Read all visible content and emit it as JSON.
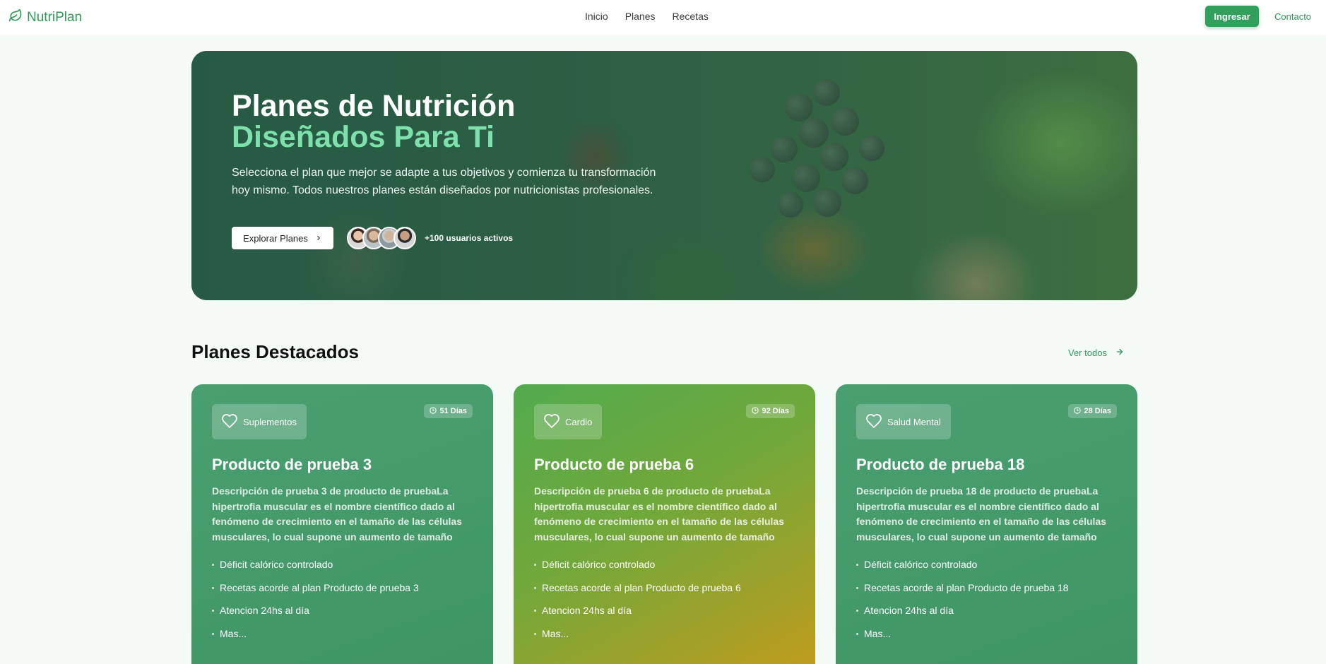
{
  "header": {
    "brand": "NutriPlan",
    "nav": [
      "Inicio",
      "Planes",
      "Recetas"
    ],
    "login_label": "Ingresar",
    "contact_label": "Contacto"
  },
  "hero": {
    "title_line1": "Planes de Nutrición",
    "title_line2": "Diseñados Para Ti",
    "description": "Selecciona el plan que mejor se adapte a tus objetivos y comienza tu transformación hoy mismo. Todos nuestros planes están diseñados por nutricionistas profesionales.",
    "explore_label": "Explorar Planes",
    "users_text": "+100 usuarios activos"
  },
  "section": {
    "title": "Planes Destacados",
    "see_all": "Ver todos"
  },
  "cards": [
    {
      "category": "Suplementos",
      "days": "51 Días",
      "title": "Producto de prueba 3",
      "description": "Descripción de prueba 3 de producto de pruebaLa hipertrofia muscular es el nombre científico dado al fenómeno de crecimiento en el tamaño de las células musculares, lo cual supone un aumento de tamaño de...",
      "features": [
        "Déficit calórico controlado",
        "Recetas acorde al plan Producto de prueba 3",
        "Atencion 24hs al día",
        "Mas..."
      ]
    },
    {
      "category": "Cardio",
      "days": "92 Días",
      "title": "Producto de prueba 6",
      "description": "Descripción de prueba 6 de producto de pruebaLa hipertrofia muscular es el nombre científico dado al fenómeno de crecimiento en el tamaño de las células musculares, lo cual supone un aumento de tamaño de...",
      "features": [
        "Déficit calórico controlado",
        "Recetas acorde al plan Producto de prueba 6",
        "Atencion 24hs al día",
        "Mas..."
      ]
    },
    {
      "category": "Salud Mental",
      "days": "28 Días",
      "title": "Producto de prueba 18",
      "description": "Descripción de prueba 18 de producto de pruebaLa hipertrofia muscular es el nombre científico dado al fenómeno de crecimiento en el tamaño de las células musculares, lo cual supone un aumento de tamaño de...",
      "features": [
        "Déficit calórico controlado",
        "Recetas acorde al plan Producto de prueba 18",
        "Atencion 24hs al día",
        "Mas..."
      ]
    }
  ],
  "colors": {
    "brand_green": "#2f9a58",
    "accent_mint": "#7ee0aa",
    "page_bg": "#f4fbf7"
  },
  "icons": [
    "leaf-icon",
    "chevron-right-icon",
    "arrow-right-icon",
    "heart-icon",
    "clock-icon"
  ]
}
